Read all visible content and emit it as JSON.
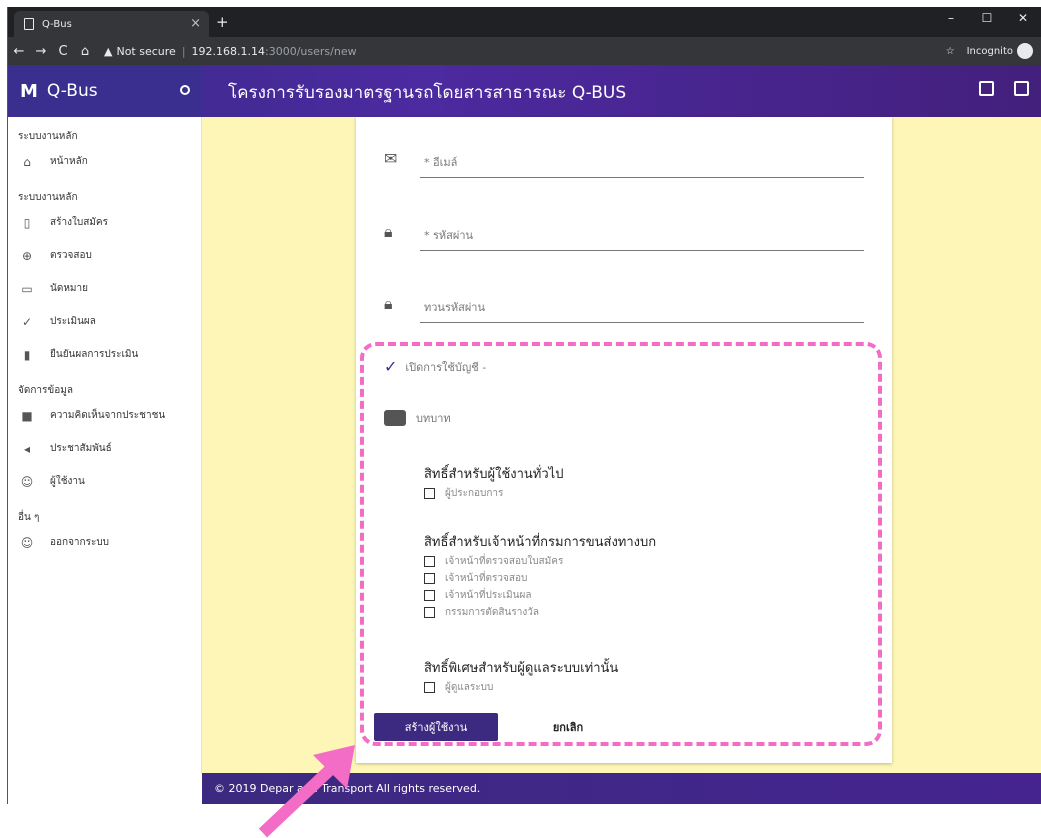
{
  "browser": {
    "tab_title": "Q-Bus",
    "tab_close": "×",
    "new_tab": "+",
    "not_secure": "Not secure",
    "url_host": "192.168.1.14",
    "url_path": ":3000/users/new",
    "incognito": "Incognito",
    "win_min": "–",
    "win_max": "☐",
    "win_close": "✕"
  },
  "app": {
    "logo": "M",
    "name": "Q-Bus",
    "title": "โครงการรับรองมาตรฐานรถโดยสารสาธารณะ Q-BUS"
  },
  "sidebar": {
    "sec1": "ระบบงานหลัก",
    "home": "หน้าหลัก",
    "sec2": "ระบบงานหลัก",
    "create_app": "สร้างใบสมัคร",
    "inspect": "ตรวจสอบ",
    "appointment": "นัดหมาย",
    "evaluate": "ประเมินผล",
    "confirm_eval": "ยืนยันผลการประเมิน",
    "sec3": "จัดการข้อมูล",
    "feedback": "ความคิดเห็นจากประชาชน",
    "pr": "ประชาสัมพันธ์",
    "users": "ผู้ใช้งาน",
    "sec4": "อื่น ๆ",
    "logout": "ออกจากระบบ"
  },
  "form": {
    "email_label": "* อีเมล์",
    "password_label": "* รหัสผ่าน",
    "confirm_label": "ทวนรหัสผ่าน",
    "enable_account": "เปิดการใช้บัญชี -",
    "role_label": "บทบาท",
    "group1_title": "สิทธิ์สำหรับผู้ใช้งานทั่วไป",
    "group1_opts": [
      "ผู้ประกอบการ"
    ],
    "group2_title": "สิทธิ์สำหรับเจ้าหน้าที่กรมการขนส่งทางบก",
    "group2_opts": [
      "เจ้าหน้าที่ตรวจสอบใบสมัคร",
      "เจ้าหน้าที่ตรวจสอบ",
      "เจ้าหน้าที่ประเมินผล",
      "กรรมการตัดสินรางวัล"
    ],
    "group3_title": "สิทธิ์พิเศษสำหรับผู้ดูแลระบบเท่านั้น",
    "group3_opts": [
      "ผู้ดูแลระบบ"
    ],
    "create_button": "สร้างผู้ใช้งาน",
    "cancel_button": "ยกเลิก"
  },
  "footer": {
    "text": "© 2019 Depar          and Transport  All rights reserved."
  },
  "colors": {
    "appbar": "#3a2f8e",
    "content_bg": "#fdf6b6",
    "annotation": "#f36cc6"
  }
}
